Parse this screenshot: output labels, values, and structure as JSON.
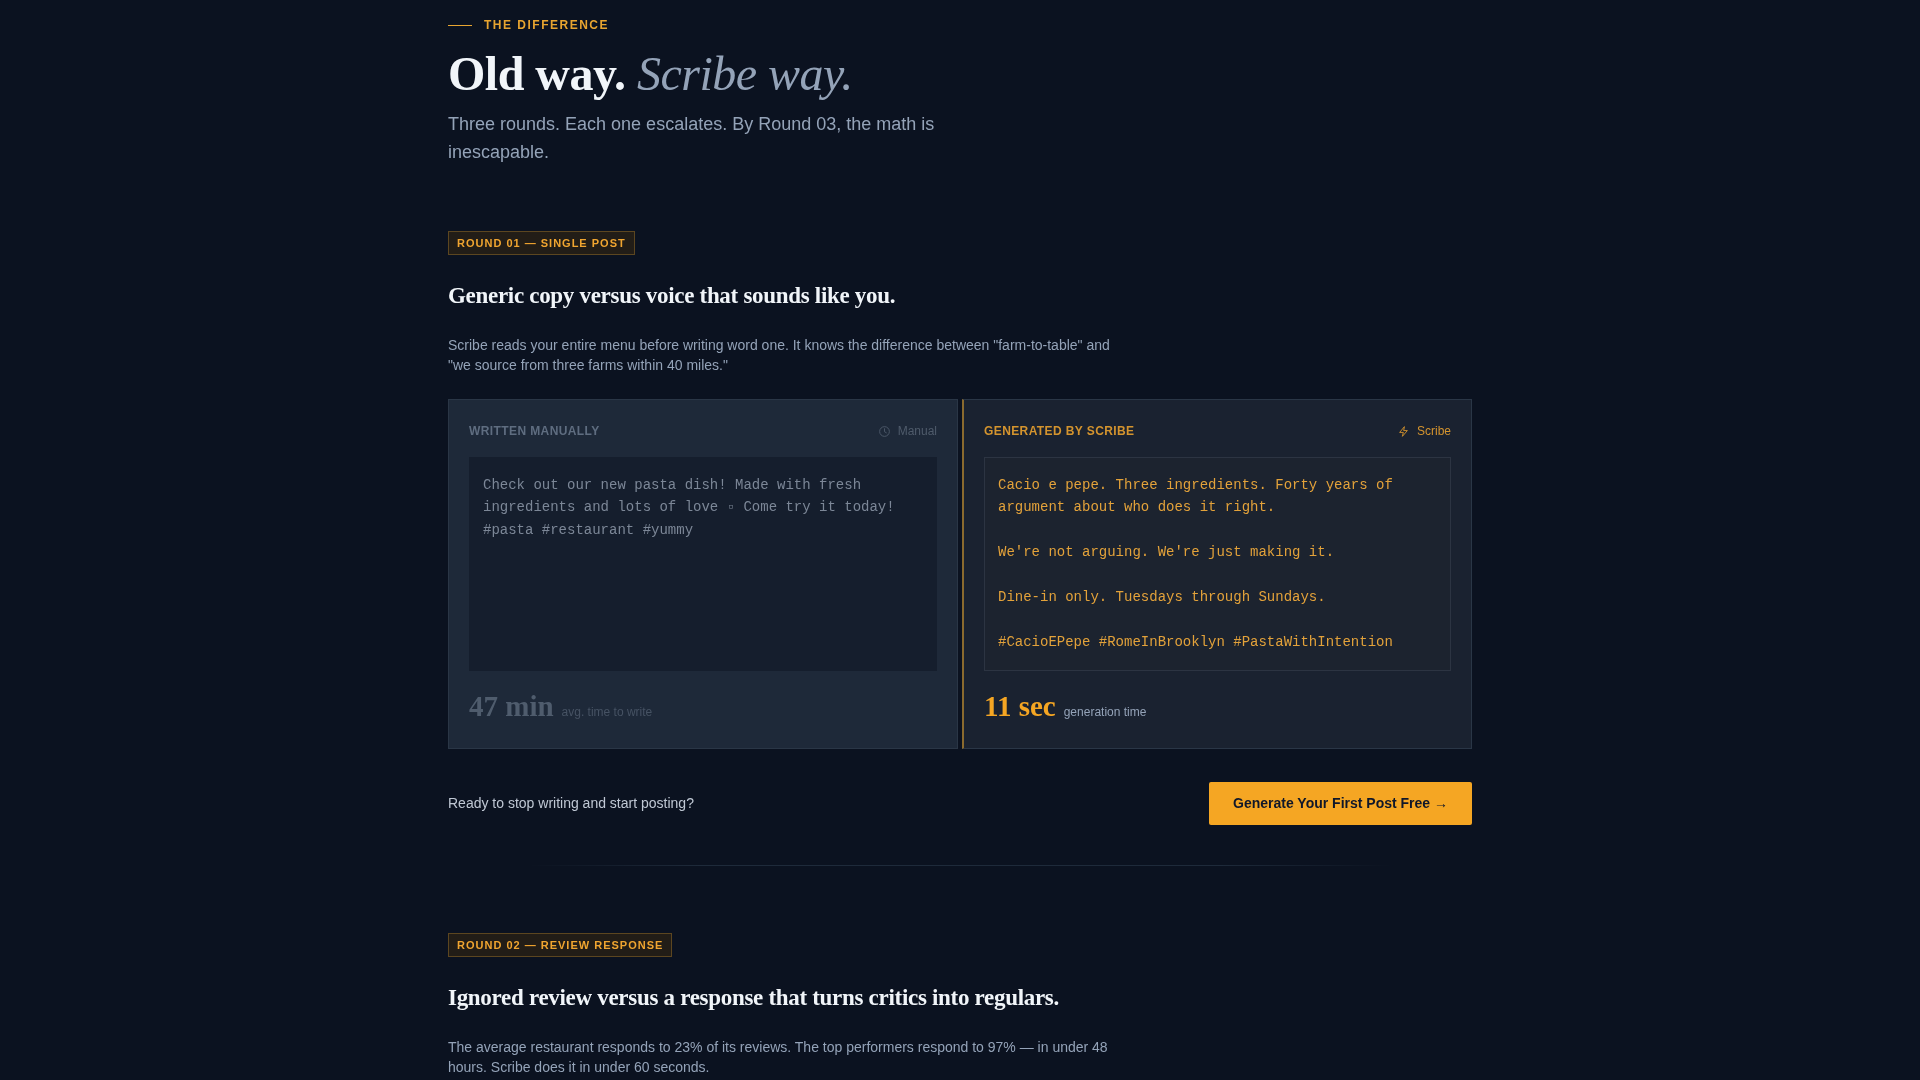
{
  "eyebrow": "THE DIFFERENCE",
  "title": "Old way. *Scribe way.*",
  "subtitle": "Three rounds. Each one escalates. By Round 03, the math is inescapable.",
  "rounds": [
    {
      "badge": "ROUND 01 — SINGLE POST",
      "heading": "Generic copy versus voice that sounds like you.",
      "description": "Scribe reads your entire menu before writing word one. It knows the difference between \"farm-to-table\" and \"we source from three farms within 40 miles.\"",
      "comparison": [
        {
          "kind": "manual",
          "label": "WRITTEN MANUALLY",
          "tag": "Manual",
          "post": [
            "Check out our new pasta dish! Made with fresh ingredients and lots of love ▫ Come try it today! #pasta #restaurant #yummy"
          ],
          "stat_value": "47 min",
          "stat_label": "avg. time to write"
        },
        {
          "kind": "scribe",
          "label": "GENERATED BY SCRIBE",
          "tag": "Scribe",
          "post": [
            "Cacio e pepe. Three ingredients. Forty years of argument about who does it right.",
            "We're not arguing. We're just making it.",
            "Dine-in only. Tuesdays through Sundays.",
            "#CacioEPepe #RomeInBrooklyn #PastaWithIntention"
          ],
          "stat_value": "11 sec",
          "stat_label": "generation time"
        }
      ],
      "cta": {
        "prompt": "Ready to stop writing and start posting?",
        "button": "Generate Your First Post Free →"
      }
    },
    {
      "badge": "ROUND 02 — REVIEW RESPONSE",
      "heading": "Ignored review versus a response that turns critics into regulars.",
      "description": "The average restaurant responds to 23% of its reviews. The top performers respond to 97% — in under 48 hours. Scribe does it in under 60 seconds."
    }
  ]
}
